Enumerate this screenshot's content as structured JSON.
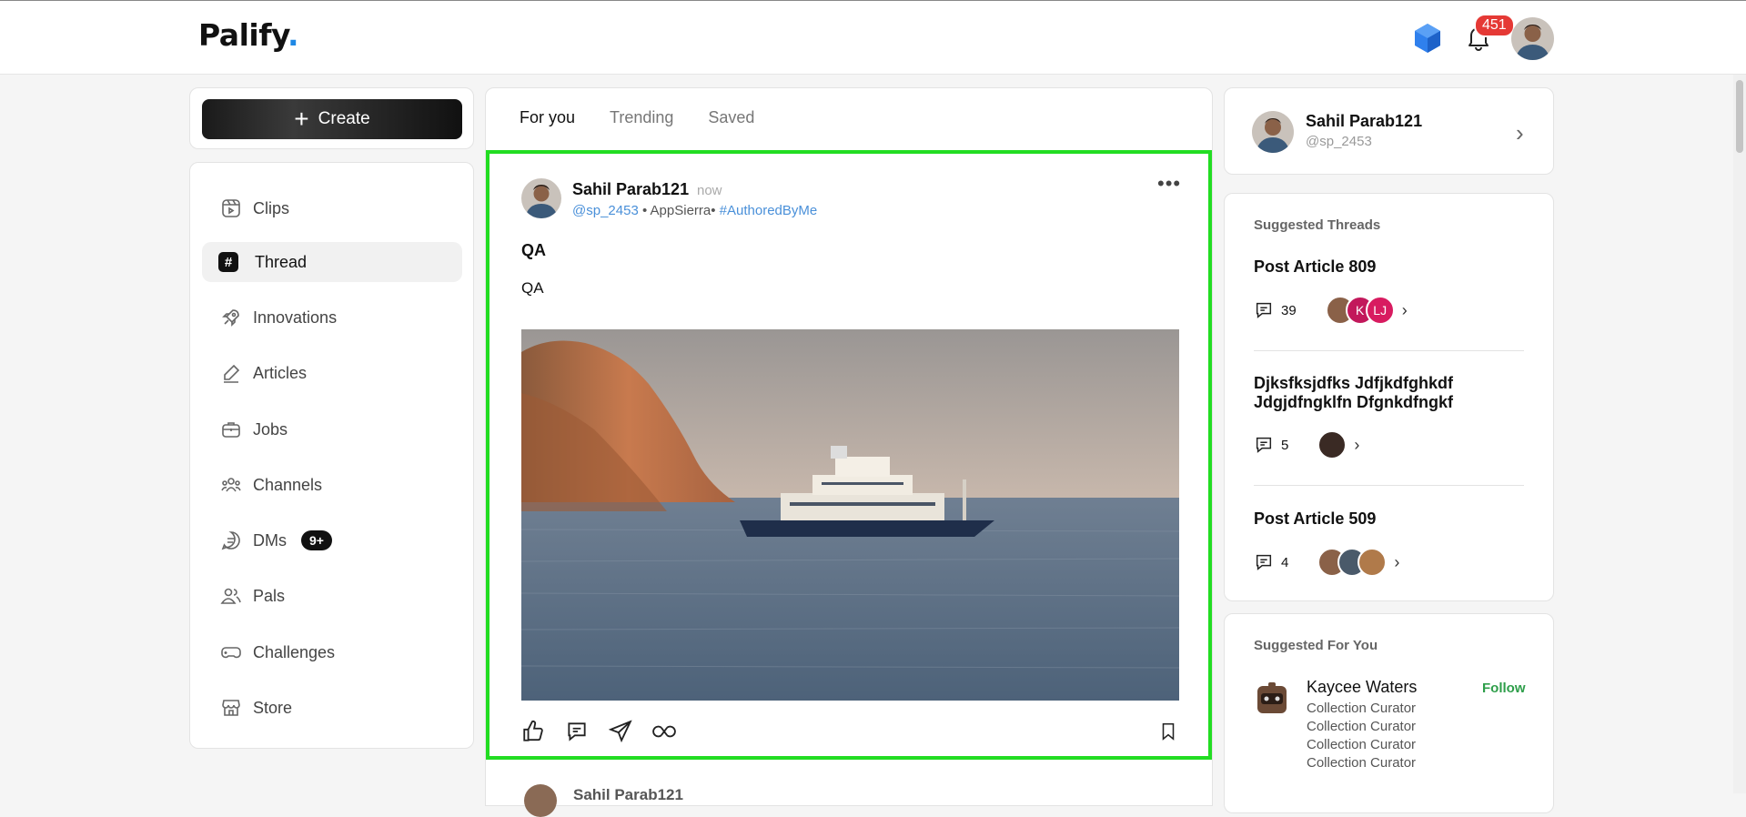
{
  "header": {
    "logo_text": "Palify",
    "logo_dot": ".",
    "notification_count": "451",
    "accent": "#1e88e5"
  },
  "sidebar": {
    "create_label": "Create",
    "items": [
      {
        "label": "Clips",
        "icon": "clips-icon"
      },
      {
        "label": "Thread",
        "icon": "hash-icon",
        "active": true
      },
      {
        "label": "Innovations",
        "icon": "rocket-icon"
      },
      {
        "label": "Articles",
        "icon": "pen-icon"
      },
      {
        "label": "Jobs",
        "icon": "briefcase-icon"
      },
      {
        "label": "Channels",
        "icon": "people-icon"
      },
      {
        "label": "DMs",
        "icon": "chat-icon",
        "badge": "9+"
      },
      {
        "label": "Pals",
        "icon": "users-icon"
      },
      {
        "label": "Challenges",
        "icon": "gamepad-icon"
      },
      {
        "label": "Store",
        "icon": "store-icon"
      }
    ]
  },
  "feed": {
    "tabs": [
      "For you",
      "Trending",
      "Saved"
    ],
    "active_tab": "For you",
    "post": {
      "author": "Sahil Parab121",
      "time": "now",
      "handle": "@sp_2453",
      "org": "AppSierra",
      "tag": "#AuthoredByMe",
      "title": "QA",
      "body": "QA",
      "more": "•••"
    },
    "next_post_author": "Sahil Parab121"
  },
  "profile": {
    "name": "Sahil Parab121",
    "handle": "@sp_2453"
  },
  "suggested_threads": {
    "heading": "Suggested Threads",
    "items": [
      {
        "title": "Post Article 809",
        "comments": "39",
        "avatars": [
          "photo",
          "K",
          "LJ"
        ]
      },
      {
        "title": "Djksfksjdfks Jdfjkdfghkdf Jdgjdfngklfn Dfgnkdfngkf",
        "comments": "5",
        "avatars": [
          "photo"
        ]
      },
      {
        "title": "Post Article 509",
        "comments": "4",
        "avatars": [
          "photo",
          "photo",
          "photo"
        ]
      }
    ]
  },
  "suggested_for_you": {
    "heading": "Suggested For You",
    "name": "Kaycee Waters",
    "follow": "Follow",
    "roles": [
      "Collection Curator",
      "Collection Curator",
      "Collection Curator",
      "Collection Curator"
    ]
  }
}
